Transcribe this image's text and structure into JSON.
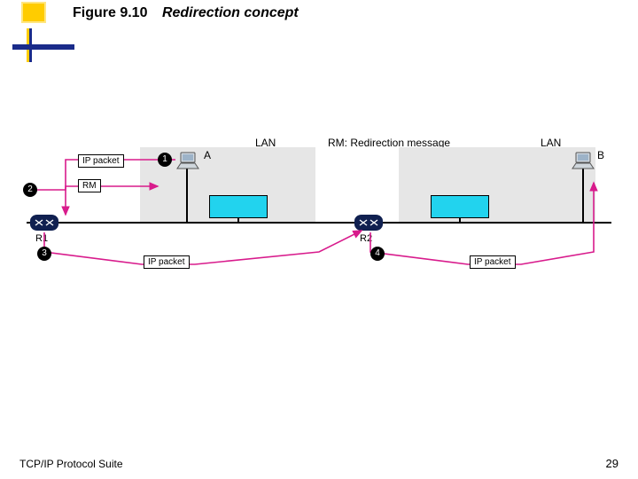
{
  "title": {
    "number": "Figure 9.10",
    "caption": "Redirection concept"
  },
  "legend": "RM: Redirection message",
  "lan": {
    "a": "LAN",
    "b": "LAN"
  },
  "hosts": {
    "a": "A",
    "b": "B"
  },
  "routers": {
    "r1": "R1",
    "r2": "R2"
  },
  "tags": {
    "ip": "IP packet",
    "rm": "RM"
  },
  "steps": {
    "s1": "1",
    "s2": "2",
    "s3": "3",
    "s4": "4"
  },
  "footer": {
    "left": "TCP/IP Protocol Suite",
    "page": "29"
  }
}
